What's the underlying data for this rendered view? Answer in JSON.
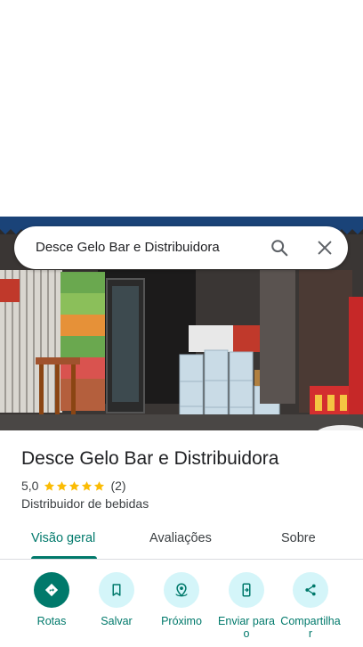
{
  "search": {
    "query": "Desce Gelo Bar e Distribuidora",
    "search_icon": "search-icon",
    "close_icon": "close-icon"
  },
  "place": {
    "title": "Desce Gelo Bar e Distribuidora",
    "rating_value": "5,0",
    "rating": 5,
    "review_count": "(2)",
    "category": "Distribuidor de bebidas"
  },
  "tabs": [
    {
      "label": "Visão geral",
      "active": true
    },
    {
      "label": "Avaliações",
      "active": false
    },
    {
      "label": "Sobre",
      "active": false
    }
  ],
  "actions": [
    {
      "label": "Rotas",
      "icon": "directions-icon"
    },
    {
      "label": "Salvar",
      "icon": "bookmark-icon"
    },
    {
      "label": "Próximo",
      "icon": "nearby-icon"
    },
    {
      "label": "Enviar para o",
      "icon": "send-to-phone-icon"
    },
    {
      "label": "Compartilhar",
      "icon": "share-icon"
    }
  ],
  "colors": {
    "accent": "#00796b",
    "action_bg": "#d4f5f9",
    "star": "#fbbc04",
    "awning": "#1e4e8c"
  }
}
